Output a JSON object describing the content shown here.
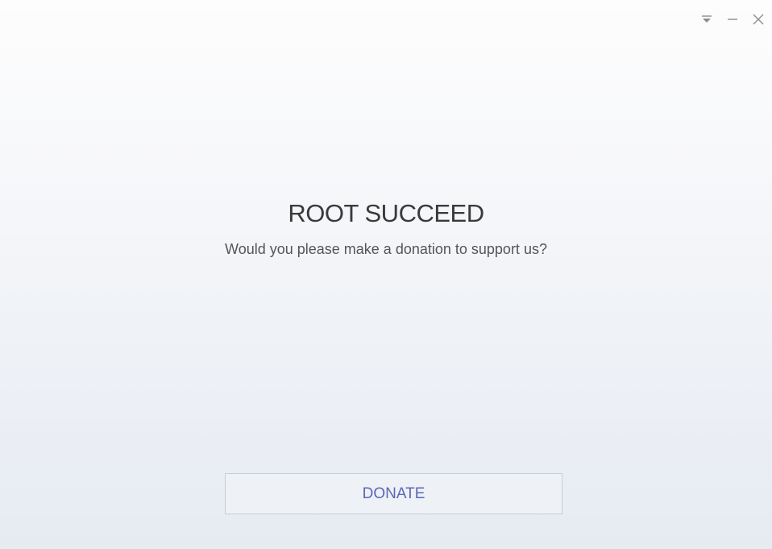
{
  "window": {
    "controls": {
      "menu_icon": "dropdown-arrow-icon",
      "minimize_icon": "minimize-icon",
      "close_icon": "close-icon"
    }
  },
  "message": {
    "title": "ROOT SUCCEED",
    "subtitle": "Would you please make a donation to support us?"
  },
  "actions": {
    "donate_label": "DONATE"
  },
  "colors": {
    "accent": "#5b67b8",
    "button_border": "#c9ccd2",
    "title_text": "#3a3a3a"
  }
}
